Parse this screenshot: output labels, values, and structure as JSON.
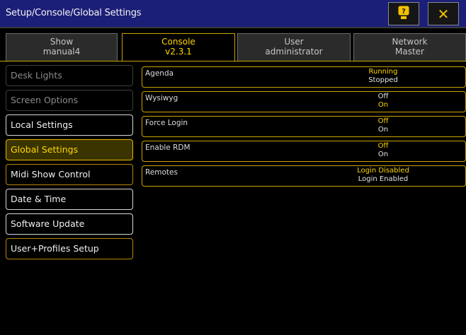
{
  "window": {
    "title": "Setup/Console/Global Settings",
    "help_icon": "help-icon",
    "close_icon": "close-icon",
    "close_glyph": "✕"
  },
  "tabs": [
    {
      "line1": "Show",
      "line2": "manual4"
    },
    {
      "line1": "Console",
      "line2": "v2.3.1"
    },
    {
      "line1": "User",
      "line2": "administrator"
    },
    {
      "line1": "Network",
      "line2": "Master"
    }
  ],
  "active_tab": "Console",
  "sidebar": {
    "items": [
      {
        "label": "Desk Lights"
      },
      {
        "label": "Screen Options"
      },
      {
        "label": "Local Settings"
      },
      {
        "label": "Global Settings"
      },
      {
        "label": "Midi Show Control"
      },
      {
        "label": "Date & Time"
      },
      {
        "label": "Software Update"
      },
      {
        "label": "User+Profiles Setup"
      }
    ],
    "selected": "Global Settings"
  },
  "settings": [
    {
      "name": "Agenda",
      "options": [
        "Running",
        "Stopped"
      ],
      "selected": "Running"
    },
    {
      "name": "Wysiwyg",
      "options": [
        "Off",
        "On"
      ],
      "selected": "On"
    },
    {
      "name": "Force Login",
      "options": [
        "Off",
        "On"
      ],
      "selected": "Off"
    },
    {
      "name": "Enable RDM",
      "options": [
        "Off",
        "On"
      ],
      "selected": "Off"
    },
    {
      "name": "Remotes",
      "options": [
        "Login Disabled",
        "Login Enabled"
      ],
      "selected": "Login Disabled"
    }
  ],
  "colors": {
    "titlebar": "#1c1f78",
    "accent": "#ffd700",
    "background": "#000000"
  }
}
